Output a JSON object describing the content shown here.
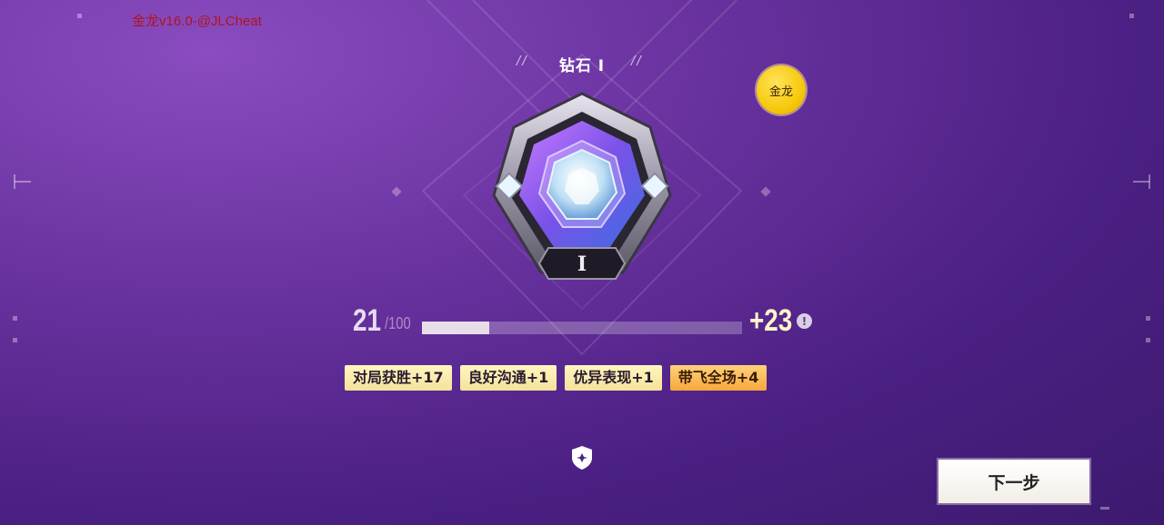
{
  "watermark": "金龙v16.0-@JLCheat",
  "rank": {
    "title": "钻石 I",
    "decor_left": "//",
    "decor_right": "//",
    "tier_numeral": "I",
    "badge_icon": "diamond-rank-badge-icon"
  },
  "currency_badge": {
    "label": "金龙"
  },
  "progress": {
    "current": "21",
    "max": "/100",
    "fraction": 0.21,
    "gain": "+23"
  },
  "bonus_tags": [
    {
      "label": "对局获胜+17",
      "color": "#f3e29a"
    },
    {
      "label": "良好沟通+1",
      "color": "#f3e29a"
    },
    {
      "label": "优异表现+1",
      "color": "#f3e29a"
    },
    {
      "label": "带飞全场+4",
      "color": "#f6a83e"
    }
  ],
  "icons": {
    "info": "info-icon",
    "shield": "shield-icon"
  },
  "actions": {
    "next_label": "下一步"
  },
  "colors": {
    "background": "#4a1f82",
    "accent": "#f7c90c"
  }
}
